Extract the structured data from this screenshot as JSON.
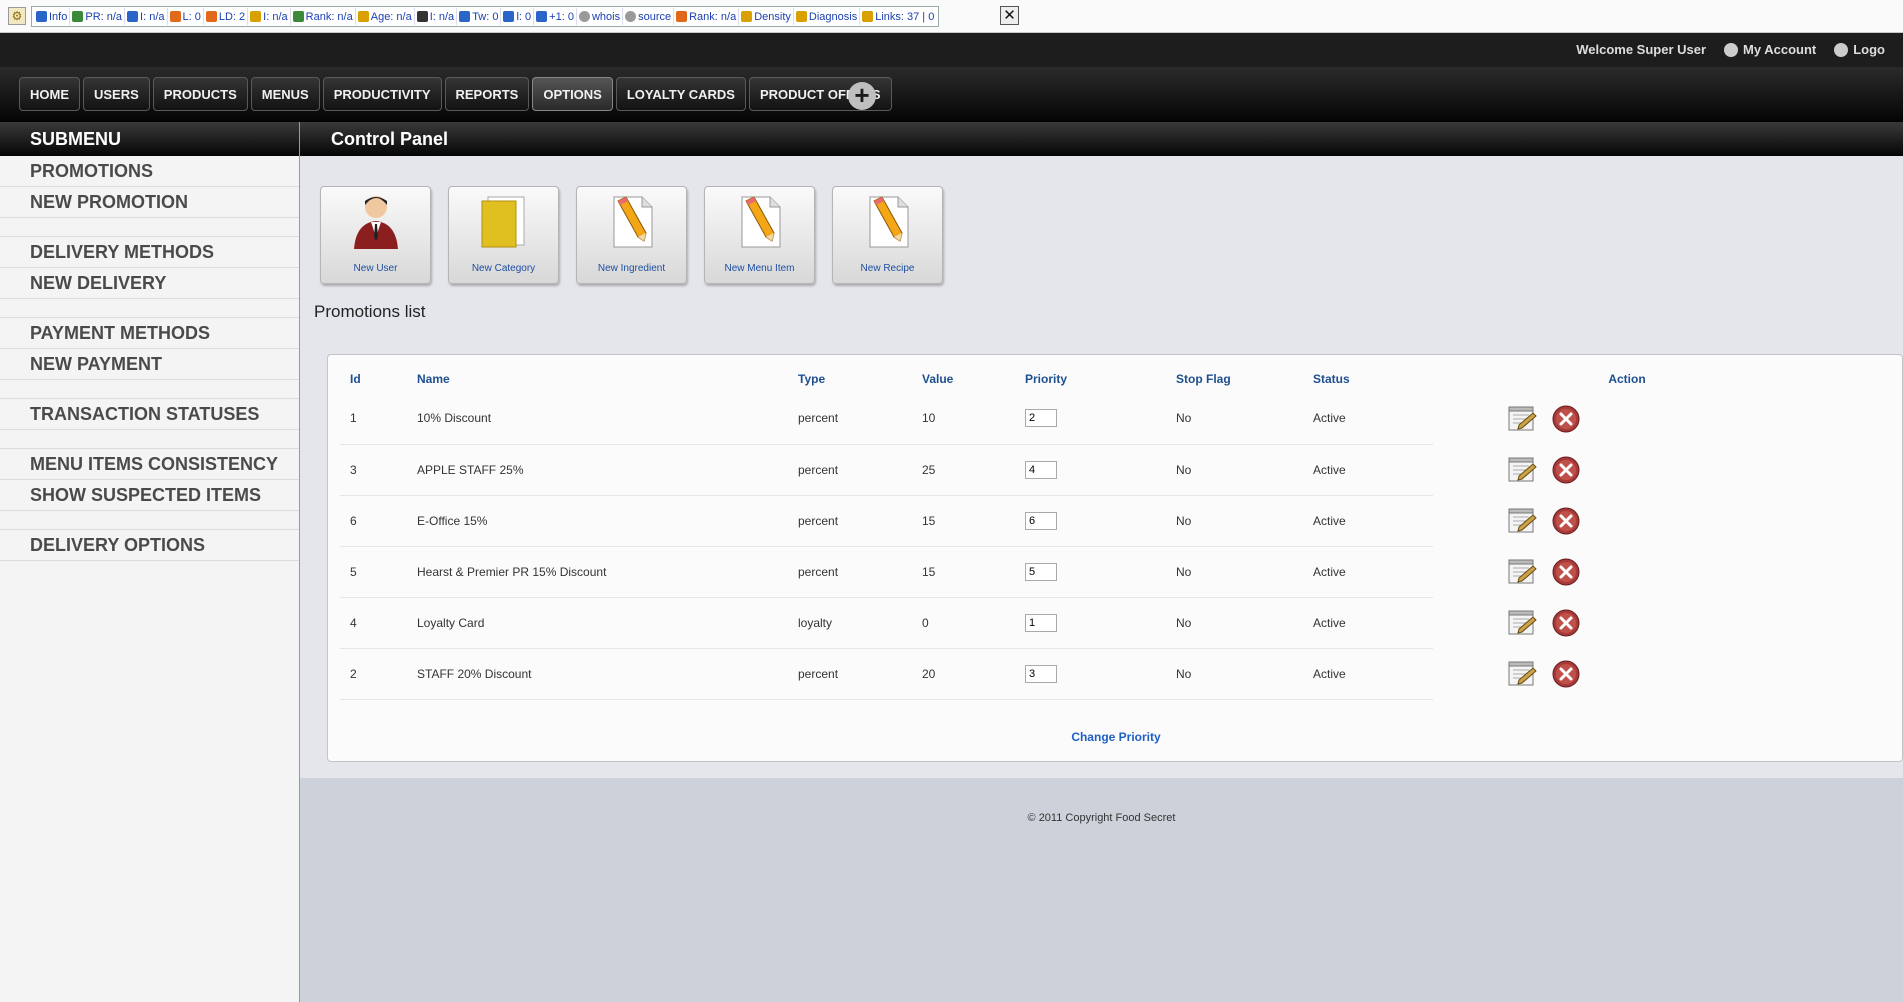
{
  "seo_bar": {
    "items": [
      {
        "icon": "info-icon",
        "text": "Info"
      },
      {
        "icon": "google-icon",
        "text": "PR: n/a"
      },
      {
        "icon": "index-icon",
        "text": "I: n/a"
      },
      {
        "icon": "links-icon",
        "text": "L: 0"
      },
      {
        "icon": "linkdomain-icon",
        "text": "LD: 2"
      },
      {
        "icon": "bing-icon",
        "text": "I: n/a"
      },
      {
        "icon": "alexa-icon",
        "text": "Rank: n/a"
      },
      {
        "icon": "age-icon",
        "text": "Age: n/a"
      },
      {
        "icon": "delicious-icon",
        "text": "I: n/a"
      },
      {
        "icon": "twitter-icon",
        "text": "Tw: 0"
      },
      {
        "icon": "facebook-icon",
        "text": "l: 0"
      },
      {
        "icon": "plusone-icon",
        "text": "+1: 0"
      },
      {
        "icon": "whois-icon",
        "text": "whois"
      },
      {
        "icon": "source-icon",
        "text": "source"
      },
      {
        "icon": "rank-icon",
        "text": "Rank: n/a"
      },
      {
        "icon": "density-icon",
        "text": "Density"
      },
      {
        "icon": "diagnosis-icon",
        "text": "Diagnosis"
      },
      {
        "icon": "links-count-icon",
        "text": "Links: 37 | 0"
      }
    ]
  },
  "topbar": {
    "welcome": "Welcome Super User",
    "my_account": "My Account",
    "logout": "Logo"
  },
  "nav": {
    "items": [
      "HOME",
      "USERS",
      "PRODUCTS",
      "MENUS",
      "PRODUCTIVITY",
      "REPORTS",
      "OPTIONS",
      "LOYALTY CARDS",
      "PRODUCT OFFERS"
    ],
    "active": "OPTIONS"
  },
  "sidebar": {
    "title": "SUBMENU",
    "groups": [
      [
        "PROMOTIONS",
        "NEW PROMOTION"
      ],
      [
        "DELIVERY METHODS",
        "NEW DELIVERY"
      ],
      [
        "PAYMENT METHODS",
        "NEW PAYMENT"
      ],
      [
        "TRANSACTION STATUSES"
      ],
      [
        "MENU ITEMS CONSISTENCY",
        "SHOW SUSPECTED ITEMS"
      ],
      [
        "DELIVERY OPTIONS"
      ]
    ]
  },
  "main": {
    "title": "Control Panel",
    "quick_icons": [
      {
        "label": "New User",
        "icon": "user-icon"
      },
      {
        "label": "New Category",
        "icon": "folder-icon"
      },
      {
        "label": "New Ingredient",
        "icon": "pencil-document-icon"
      },
      {
        "label": "New Menu Item",
        "icon": "pencil-document-icon"
      },
      {
        "label": "New Recipe",
        "icon": "pencil-document-icon"
      }
    ],
    "list_title": "Promotions list",
    "columns": [
      "Id",
      "Name",
      "Type",
      "Value",
      "Priority",
      "Stop Flag",
      "Status",
      "Action"
    ],
    "rows": [
      {
        "id": "1",
        "name": "10% Discount",
        "type": "percent",
        "value": "10",
        "priority": "2",
        "stop_flag": "No",
        "status": "Active"
      },
      {
        "id": "3",
        "name": "APPLE STAFF 25%",
        "type": "percent",
        "value": "25",
        "priority": "4",
        "stop_flag": "No",
        "status": "Active"
      },
      {
        "id": "6",
        "name": "E-Office 15%",
        "type": "percent",
        "value": "15",
        "priority": "6",
        "stop_flag": "No",
        "status": "Active"
      },
      {
        "id": "5",
        "name": "Hearst & Premier PR 15% Discount",
        "type": "percent",
        "value": "15",
        "priority": "5",
        "stop_flag": "No",
        "status": "Active"
      },
      {
        "id": "4",
        "name": "Loyalty Card",
        "type": "loyalty",
        "value": "0",
        "priority": "1",
        "stop_flag": "No",
        "status": "Active"
      },
      {
        "id": "2",
        "name": "STAFF 20% Discount",
        "type": "percent",
        "value": "20",
        "priority": "3",
        "stop_flag": "No",
        "status": "Active"
      }
    ],
    "change_priority": "Change Priority",
    "footer": "© 2011 Copyright Food Secret"
  }
}
